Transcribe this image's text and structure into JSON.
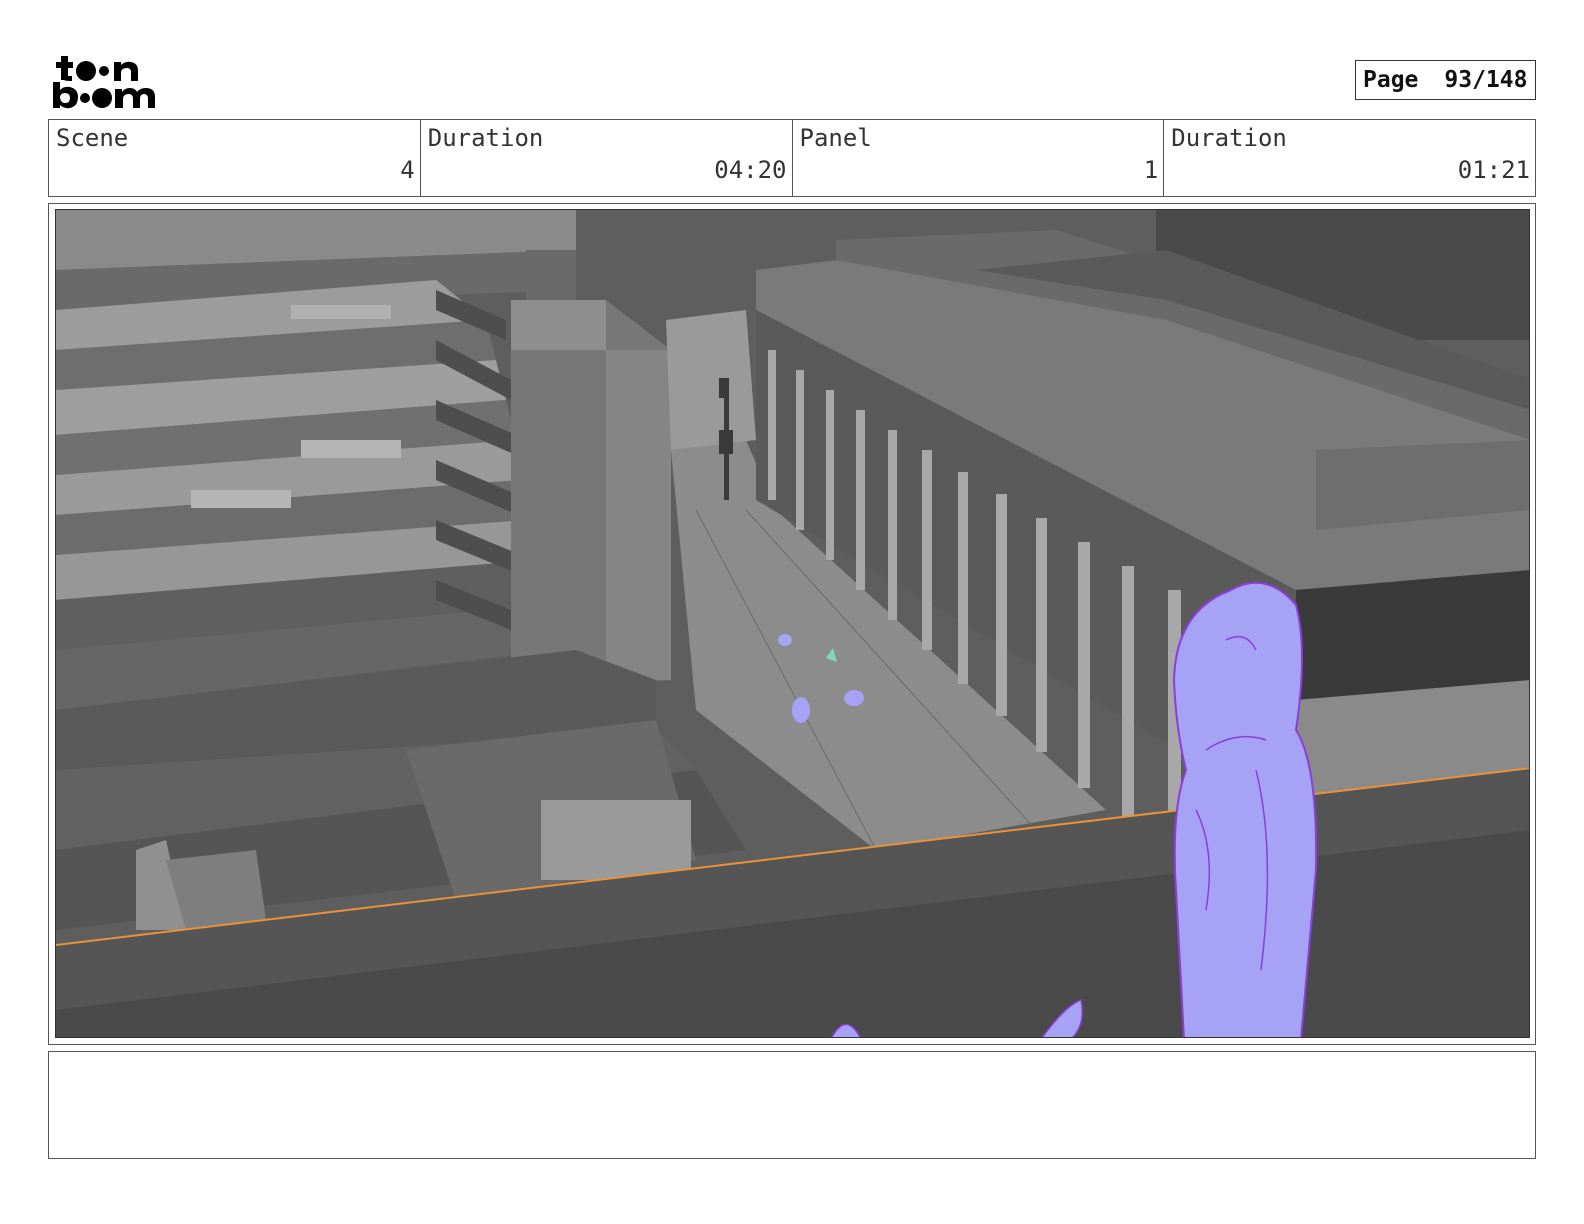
{
  "logo": {
    "line1": "toon",
    "line2": "boom"
  },
  "page": {
    "label": "Page",
    "value": "93/148"
  },
  "info": [
    {
      "label": "Scene",
      "value": "4"
    },
    {
      "label": "Duration",
      "value": "04:20"
    },
    {
      "label": "Panel",
      "value": "1"
    },
    {
      "label": "Duration",
      "value": "01:21"
    }
  ],
  "panel": {
    "colors": {
      "character": "#a6a3f7",
      "character_line": "#8a3fd6",
      "ledge_line": "#e8923a"
    }
  },
  "notes": {
    "text": ""
  }
}
